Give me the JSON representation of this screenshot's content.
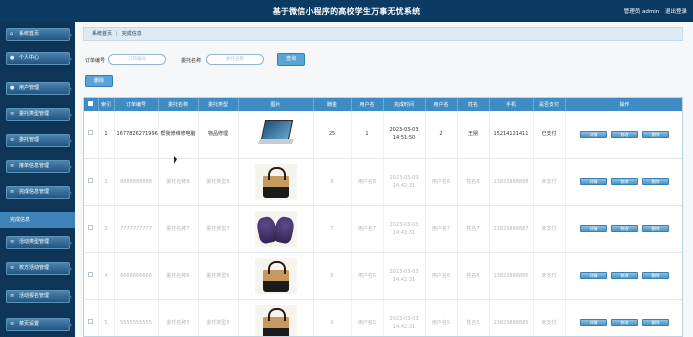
{
  "header": {
    "title": "基于微信小程序的高校学生万事无忧系统",
    "user_label": "管理员 admin",
    "logout": "退出登录"
  },
  "sidebar": {
    "items": [
      {
        "label": "系统首页",
        "icon": "home-icon"
      },
      {
        "label": "个人中心",
        "icon": "user-icon"
      },
      {
        "label": "用户管理",
        "icon": "users-icon"
      },
      {
        "label": "委托类型管理",
        "icon": "list-icon"
      },
      {
        "label": "委托管理",
        "icon": "list-icon"
      },
      {
        "label": "接单信息管理",
        "icon": "list-icon"
      },
      {
        "label": "完成信息管理",
        "icon": "list-icon"
      },
      {
        "label": "活动类型管理",
        "icon": "list-icon"
      },
      {
        "label": "校方活动管理",
        "icon": "list-icon"
      },
      {
        "label": "活动报名管理",
        "icon": "list-icon"
      },
      {
        "label": "菜页设置",
        "icon": "list-icon"
      }
    ],
    "active_label": "完成信息"
  },
  "breadcrumb": {
    "home": "系统首页",
    "current": "完成信息"
  },
  "search": {
    "order_label": "订单编号",
    "order_placeholder": "订单编号",
    "name_label": "委托名称",
    "name_placeholder": "委托名称",
    "query_button": "查询"
  },
  "actions": {
    "delete_button": "删除"
  },
  "table": {
    "headers": [
      "",
      "索引",
      "订单编号",
      "委托名称",
      "委托类型",
      "图片",
      "酬金",
      "用户名",
      "完成时间",
      "用户名",
      "姓名",
      "手机",
      "是否支付",
      "操作"
    ],
    "rows": [
      {
        "index": "1",
        "order": "1677826271996",
        "name": "帮我修维修电脑",
        "type": "物品修理",
        "image": "laptop",
        "reward": "25",
        "user": "1",
        "time": "2023-03-03 14:51:50",
        "user2": "2",
        "realname": "王朋",
        "phone": "15214121411",
        "paid": "已支付"
      },
      {
        "index": "2",
        "order": "8888888888",
        "name": "委托名称8",
        "type": "委托类型8",
        "image": "bag",
        "reward": "8",
        "user": "用户名8",
        "time": "2023-03-03 14:42:31",
        "user2": "用户名8",
        "realname": "姓名8",
        "phone": "13823888888",
        "paid": "未支付"
      },
      {
        "index": "3",
        "order": "7777777777",
        "name": "委托名称7",
        "type": "委托类型7",
        "image": "shoe",
        "reward": "7",
        "user": "用户名7",
        "time": "2023-03-03 14:42:31",
        "user2": "用户名7",
        "realname": "姓名7",
        "phone": "13823888887",
        "paid": "未支付"
      },
      {
        "index": "4",
        "order": "6666666666",
        "name": "委托名称6",
        "type": "委托类型6",
        "image": "bag",
        "reward": "6",
        "user": "用户名6",
        "time": "2023-03-03 14:42:31",
        "user2": "用户名6",
        "realname": "姓名6",
        "phone": "13823888886",
        "paid": "未支付"
      },
      {
        "index": "5",
        "order": "5555555555",
        "name": "委托名称5",
        "type": "委托类型5",
        "image": "bag",
        "reward": "5",
        "user": "用户名5",
        "time": "2023-03-03 14:42:31",
        "user2": "用户名5",
        "realname": "姓名5",
        "phone": "13823888885",
        "paid": "未支付"
      }
    ],
    "op_labels": [
      "详情",
      "修改",
      "删除"
    ]
  }
}
